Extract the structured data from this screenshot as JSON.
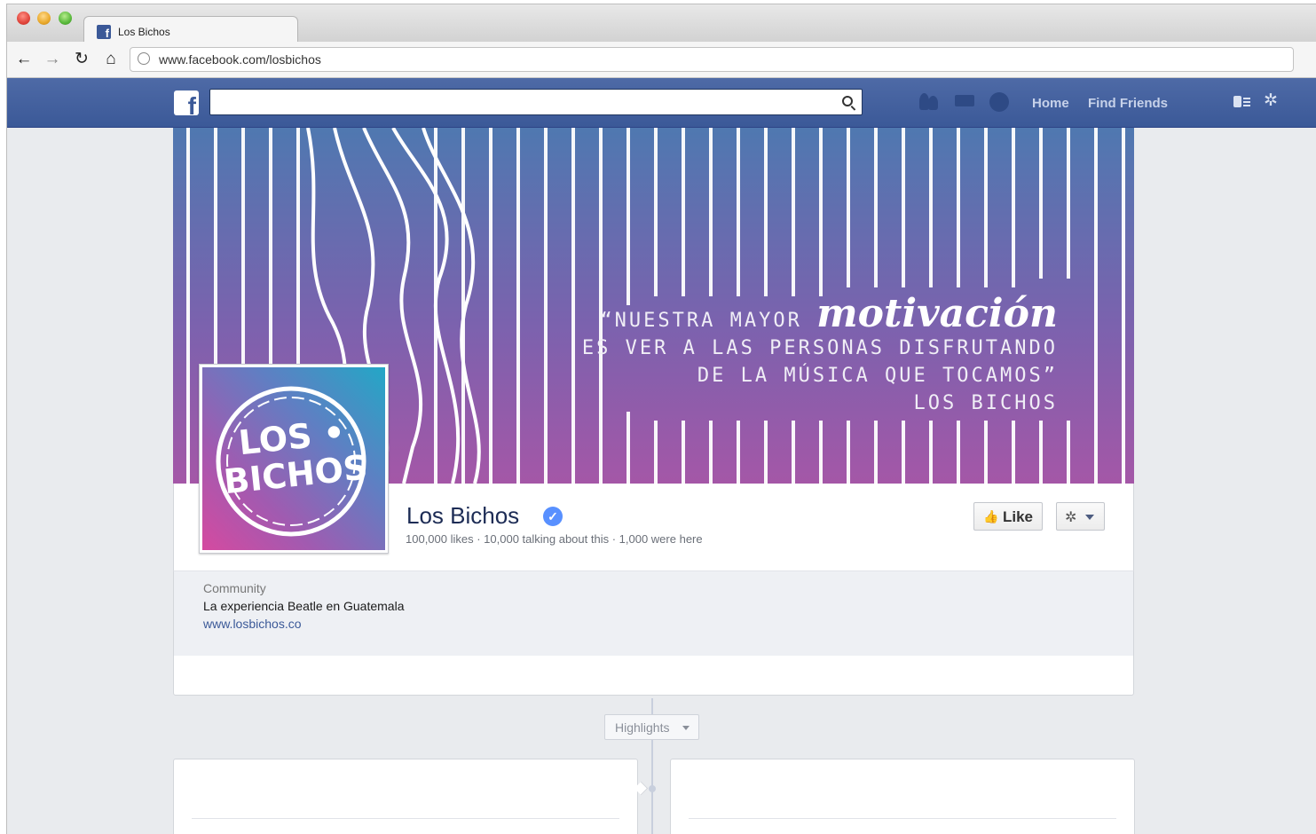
{
  "browser": {
    "tab_title": "Los Bichos",
    "url": "www.facebook.com/losbichos",
    "favicon": "facebook-icon"
  },
  "facebook_header": {
    "logo": "facebook-logo",
    "search_placeholder": "",
    "links": {
      "home": "Home",
      "find_friends": "Find Friends"
    },
    "brand_color": "#3b5998"
  },
  "cover": {
    "quote_word_1": "“NUESTRA MAYOR",
    "quote_highlight": "motivación",
    "quote_line_2": "ES VER A LAS PERSONAS DISFRUTANDO",
    "quote_line_3": "DE LA MÚSICA QUE TOCAMOS”",
    "quote_author": "LOS BICHOS",
    "gradient_top": "#4f78b0",
    "gradient_bottom": "#a457a7"
  },
  "profile": {
    "logo_text": "LOS • BICHOS",
    "name": "Los Bichos",
    "verified": true,
    "stats": "100,000 likes · 10,000 talking about this · 1,000 were here",
    "like_label": "Like"
  },
  "about": {
    "category": "Community",
    "description": "La experiencia Beatle en Guatemala",
    "website": "www.losbichos.co"
  },
  "timeline": {
    "highlights_label": "Highlights"
  }
}
